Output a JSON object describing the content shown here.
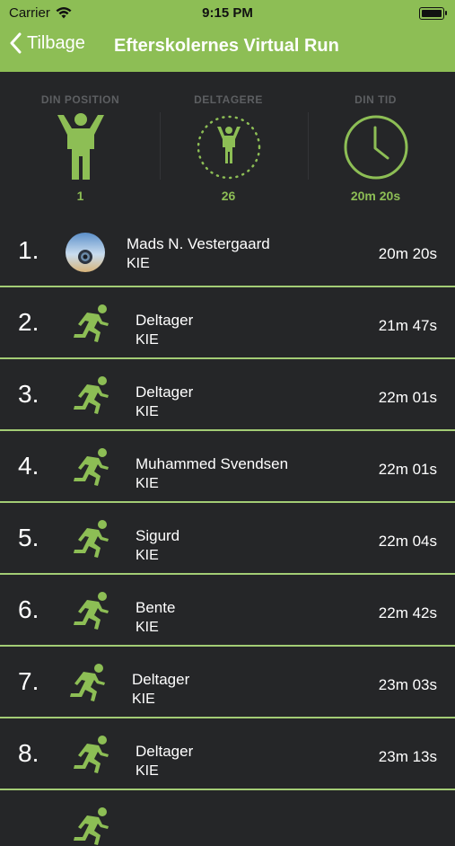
{
  "status": {
    "carrier": "Carrier",
    "time": "9:15 PM"
  },
  "nav": {
    "back_label": "Tilbage",
    "title": "Efterskolernes Virtual Run"
  },
  "summary": {
    "position_label": "DIN POSITION",
    "position_value": "1",
    "participants_label": "DELTAGERE",
    "participants_value": "26",
    "time_label": "DIN TID",
    "time_value": "20m 20s"
  },
  "leaderboard": [
    {
      "rank": "1.",
      "name": "Mads N. Vestergaard",
      "school": "KIE",
      "time": "20m 20s"
    },
    {
      "rank": "2.",
      "name": "Deltager",
      "school": "KIE",
      "time": "21m 47s"
    },
    {
      "rank": "3.",
      "name": "Deltager",
      "school": "KIE",
      "time": "22m 01s"
    },
    {
      "rank": "4.",
      "name": "Muhammed Svendsen",
      "school": "KIE",
      "time": "22m 01s"
    },
    {
      "rank": "5.",
      "name": "Sigurd",
      "school": "KIE",
      "time": "22m 04s"
    },
    {
      "rank": "6.",
      "name": "Bente",
      "school": "KIE",
      "time": "22m 42s"
    },
    {
      "rank": "7.",
      "name": "Deltager",
      "school": "KIE",
      "time": "23m 03s"
    },
    {
      "rank": "8.",
      "name": "Deltager",
      "school": "KIE",
      "time": "23m 13s"
    }
  ],
  "colors": {
    "accent": "#8dbe55",
    "background": "#252628",
    "muted_label": "#5d5f62"
  },
  "icons": {
    "back": "chevron-left-icon",
    "position": "person-arms-up-icon",
    "participants": "person-dotted-circle-icon",
    "time": "clock-icon",
    "runner": "running-person-icon"
  }
}
